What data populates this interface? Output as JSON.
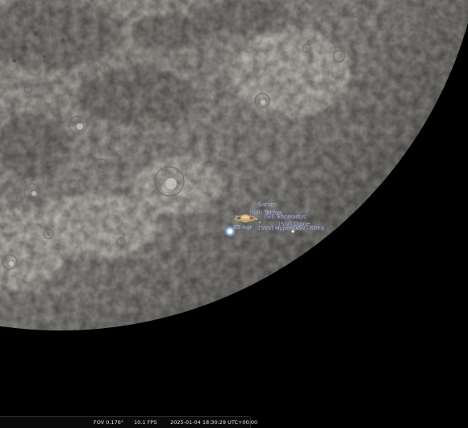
{
  "objects": {
    "planet": {
      "label": "Saturn"
    },
    "moons": [
      {
        "label": "(SIII) Tethys"
      },
      {
        "label": "(SII) Enceladus"
      },
      {
        "label": "(SIV) Dione"
      },
      {
        "label": "(SVII) Hyperion"
      },
      {
        "label": "(SV) Rhea"
      }
    ],
    "star": {
      "label": "85-Aqr"
    }
  },
  "status_bar": {
    "fov": "FOV 0.176°",
    "fps": "10.1 FPS",
    "datetime": "2025-01-04 18:30:29 UTC+00:00"
  },
  "colors": {
    "sky": "#000000",
    "moon_highlands": "#a3a19b",
    "moon_maria": "#7d7b76",
    "label": "#a8aeec",
    "star": "#9fc0ff",
    "saturn": "#d8b173"
  },
  "icons": {
    "saturn": "saturn-planet",
    "star": "bright-star"
  }
}
